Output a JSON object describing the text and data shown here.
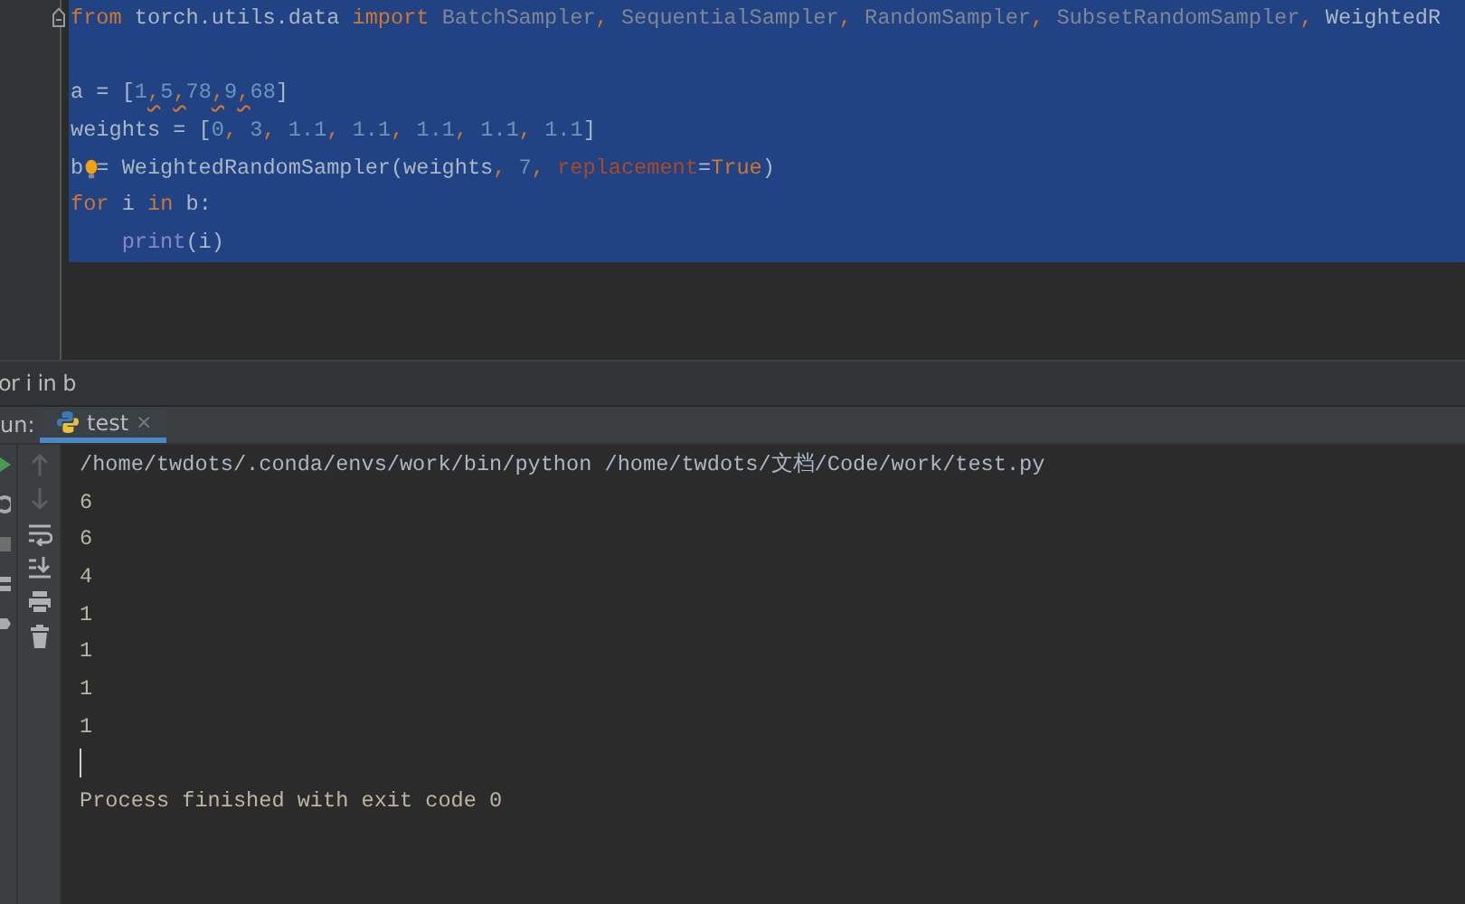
{
  "editor": {
    "lines": [
      {
        "selected": true,
        "tokens": [
          {
            "text": "from",
            "kind": "keyword"
          },
          {
            "text": " torch.utils.data ",
            "kind": "ident"
          },
          {
            "text": "import",
            "kind": "keyword"
          },
          {
            "text": " BatchSampler",
            "kind": "unused"
          },
          {
            "text": ", ",
            "kind": "comma"
          },
          {
            "text": "SequentialSampler",
            "kind": "unused"
          },
          {
            "text": ", ",
            "kind": "comma"
          },
          {
            "text": "RandomSampler",
            "kind": "unused"
          },
          {
            "text": ", ",
            "kind": "comma"
          },
          {
            "text": "SubsetRandomSampler",
            "kind": "unused"
          },
          {
            "text": ", ",
            "kind": "comma"
          },
          {
            "text": "WeightedR",
            "kind": "ident"
          }
        ]
      },
      {
        "selected": true
      },
      {
        "selected": true,
        "tokens": [
          {
            "text": "a = [",
            "kind": "ident"
          },
          {
            "text": "1",
            "kind": "number"
          },
          {
            "text": ",",
            "kind": "warn"
          },
          {
            "text": "5",
            "kind": "number"
          },
          {
            "text": ",",
            "kind": "warn"
          },
          {
            "text": "78",
            "kind": "number"
          },
          {
            "text": ",",
            "kind": "warn"
          },
          {
            "text": "9",
            "kind": "number"
          },
          {
            "text": ",",
            "kind": "warn"
          },
          {
            "text": "68",
            "kind": "number"
          },
          {
            "text": "]",
            "kind": "ident"
          }
        ]
      },
      {
        "selected": true,
        "tokens": [
          {
            "text": "weights = [",
            "kind": "ident"
          },
          {
            "text": "0",
            "kind": "number"
          },
          {
            "text": ", ",
            "kind": "comma"
          },
          {
            "text": "3",
            "kind": "number"
          },
          {
            "text": ", ",
            "kind": "comma"
          },
          {
            "text": "1.1",
            "kind": "number"
          },
          {
            "text": ", ",
            "kind": "comma"
          },
          {
            "text": "1.1",
            "kind": "number"
          },
          {
            "text": ", ",
            "kind": "comma"
          },
          {
            "text": "1.1",
            "kind": "number"
          },
          {
            "text": ", ",
            "kind": "comma"
          },
          {
            "text": "1.1",
            "kind": "number"
          },
          {
            "text": ", ",
            "kind": "comma"
          },
          {
            "text": "1.1",
            "kind": "number"
          },
          {
            "text": "]",
            "kind": "ident"
          }
        ]
      },
      {
        "selected": true,
        "bulb": true,
        "tokens": [
          {
            "text": "b = WeightedRandomSampler(weights",
            "kind": "ident"
          },
          {
            "text": ", ",
            "kind": "comma"
          },
          {
            "text": "7",
            "kind": "number"
          },
          {
            "text": ", ",
            "kind": "comma"
          },
          {
            "text": "replacement",
            "kind": "param"
          },
          {
            "text": "=",
            "kind": "ident"
          },
          {
            "text": "True",
            "kind": "keyword"
          },
          {
            "text": ")",
            "kind": "ident"
          }
        ]
      },
      {
        "selected": true,
        "tokens": [
          {
            "text": "for",
            "kind": "keyword"
          },
          {
            "text": " i ",
            "kind": "ident"
          },
          {
            "text": "in",
            "kind": "keyword"
          },
          {
            "text": " b:",
            "kind": "ident"
          }
        ]
      },
      {
        "selected": true,
        "tokens": [
          {
            "text": "    print",
            "kind": "builtin"
          },
          {
            "text": "(i)",
            "kind": "ident"
          }
        ]
      }
    ]
  },
  "breadcrumb": "or i in b",
  "run_panel": {
    "label": "un:",
    "tabs": [
      {
        "label": "test",
        "selected": true,
        "close": "×"
      }
    ],
    "console": [
      {
        "kind": "command",
        "text": "/home/twdots/.conda/envs/work/bin/python /home/twdots/文档/Code/work/test.py"
      },
      {
        "kind": "output",
        "text": "6"
      },
      {
        "kind": "output",
        "text": "6"
      },
      {
        "kind": "output",
        "text": "4"
      },
      {
        "kind": "output",
        "text": "1"
      },
      {
        "kind": "output",
        "text": "1"
      },
      {
        "kind": "output",
        "text": "1"
      },
      {
        "kind": "output",
        "text": "1"
      },
      {
        "kind": "cursor"
      },
      {
        "kind": "output",
        "text": "Process finished with exit code 0"
      }
    ]
  }
}
